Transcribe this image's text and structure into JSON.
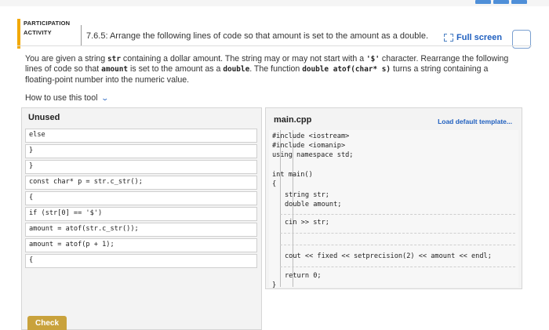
{
  "activity": {
    "label_line1": "PARTICIPATION",
    "label_line2": "ACTIVITY",
    "title": "7.6.5: Arrange the following lines of code so that amount is set to the amount as a double.",
    "fullscreen_label": "Full screen"
  },
  "instructions": {
    "p1": "You are given a string ",
    "c1": "str",
    "p2": " containing a dollar amount. The string may or may not start with a ",
    "c2": "'$'",
    "p3": " character. Rearrange the following lines of code so that ",
    "c3": "amount",
    "p4": " is set to the amount as a ",
    "c4": "double",
    "p5": ". The function ",
    "c5": "double atof(char* s)",
    "p6": " turns a string containing a floating-point number into the numeric value."
  },
  "howto": {
    "label": "How to use this tool"
  },
  "unused": {
    "title": "Unused",
    "blocks": [
      "else",
      "}",
      "}",
      "const char* p = str.c_str();",
      "{",
      "if (str[0] == '$')",
      "amount = atof(str.c_str());",
      "amount = atof(p + 1);",
      "{"
    ]
  },
  "editor": {
    "file_name": "main.cpp",
    "load_template": "Load default template...",
    "lines": {
      "l1": "#include <iostream>",
      "l2": "#include <iomanip>",
      "l3": "using namespace std;",
      "l4": "int main()",
      "l5": "{",
      "l6": "string str;",
      "l7": "double amount;",
      "l8": "cin >> str;",
      "l9": "cout << fixed << setprecision(2) << amount << endl;",
      "l10": "return 0;",
      "l11": "}"
    }
  },
  "check_button": "Check",
  "colors": {
    "accent": "#f2a900",
    "link": "#1f5fbf",
    "check": "#c9a23c",
    "progress": "#4f8fd8"
  }
}
